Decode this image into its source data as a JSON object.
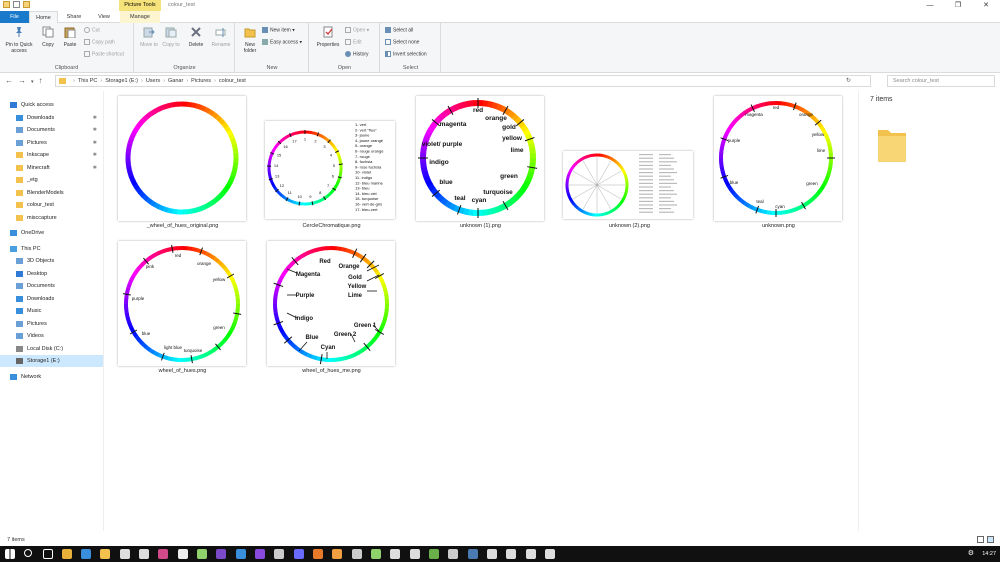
{
  "window": {
    "title": "colour_test",
    "context_tab": "Picture Tools",
    "controls": [
      "—",
      "❐",
      "✕"
    ]
  },
  "tabs": [
    "File",
    "Home",
    "Share",
    "View",
    "Manage"
  ],
  "ribbon": {
    "clipboard": {
      "label": "Clipboard",
      "pin": "Pin to Quick access",
      "copy": "Copy",
      "paste": "Paste",
      "cut": "Cut",
      "copy_path": "Copy path",
      "paste_shortcut": "Paste shortcut"
    },
    "organize": {
      "label": "Organize",
      "move_to": "Move to",
      "copy_to": "Copy to",
      "delete": "Delete",
      "rename": "Rename"
    },
    "new": {
      "label": "New",
      "new_folder": "New folder",
      "new_item": "New item",
      "easy_access": "Easy access"
    },
    "open": {
      "label": "Open",
      "properties": "Properties",
      "open": "Open",
      "edit": "Edit",
      "history": "History"
    },
    "select": {
      "label": "Select",
      "select_all": "Select all",
      "select_none": "Select none",
      "invert": "Invert selection"
    }
  },
  "address": {
    "crumbs": [
      "This PC",
      "Storage1 (E:)",
      "Users",
      "Ganar",
      "Pictures",
      "colour_test"
    ],
    "search_placeholder": "Search colour_test"
  },
  "nav": {
    "quick_access": "Quick access",
    "quick_items": [
      "Downloads",
      "Documents",
      "Pictures",
      "Inkscape",
      "Minecraft",
      "_etg",
      "BlenderModels",
      "colour_test",
      "misccapture"
    ],
    "onedrive": "OneDrive",
    "this_pc": "This PC",
    "pc_items": [
      "3D Objects",
      "Desktop",
      "Documents",
      "Downloads",
      "Music",
      "Pictures",
      "Videos",
      "Local Disk (C:)",
      "Storage1 (E:)"
    ],
    "network": "Network"
  },
  "files": [
    "_wheel_of_hues_original.png",
    "CercleChromatique.png",
    "unknown (1).png",
    "unknown (2).png",
    "unknown.png",
    "wheel_of_hues.png",
    "wheel_of_hues_me.png"
  ],
  "cercle_legend": [
    "1- vert",
    "2- vert \"fluo\"",
    "3- jaune",
    "4- jaune orangé",
    "5- orange",
    "6- rouge orangé",
    "7- rouge",
    "8- fuchsia",
    "9- rose fuchsia",
    "10- violet",
    "11- indigo",
    "12- bleu marine",
    "13- bleu",
    "14- bleu ciel",
    "15- turquoise",
    "16- vert-de-gris",
    "17- bleu-vert"
  ],
  "unknown1_labels": [
    "red",
    "orange",
    "gold",
    "yellow",
    "lime",
    "green",
    "turquoise",
    "cyan",
    "teal",
    "blue",
    "indigo",
    "violet/ purple",
    "magenta"
  ],
  "unknown_labels": [
    "magenta",
    "red",
    "orange",
    "yellow",
    "lime",
    "purple",
    "blue",
    "green",
    "teal",
    "cyan"
  ],
  "hues_labels": [
    "red",
    "pink",
    "orange",
    "yellow",
    "purple",
    "green",
    "blue",
    "light blue",
    "turquoise"
  ],
  "hues_me_labels": [
    "Red",
    "Magenta",
    "Orange",
    "Gold",
    "Yellow",
    "Lime",
    "Purple",
    "Indigo",
    "Green 1",
    "Blue",
    "Green 2",
    "Cyan"
  ],
  "details": {
    "count": "7 items"
  },
  "status": {
    "count": "7 items"
  },
  "taskbar": {
    "time": "14:27"
  }
}
